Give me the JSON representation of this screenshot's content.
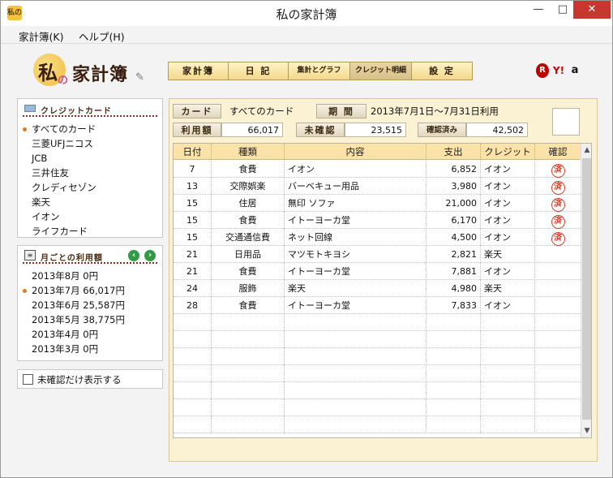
{
  "window": {
    "title": "私の家計簿",
    "icon_label": "私の"
  },
  "window_buttons": {
    "minimize": "—",
    "maximize": "□",
    "close": "✕"
  },
  "menu": {
    "items": [
      "家計簿(K)",
      "ヘルプ(H)"
    ]
  },
  "logo": {
    "part1": "私",
    "part2": "の",
    "part3": "家計簿"
  },
  "tabs": [
    "家計簿",
    "日 記",
    "集計とグラフ",
    "クレジット明細",
    "設 定"
  ],
  "active_tab": "クレジット明細",
  "partners": {
    "rakuten": "R",
    "yahoo": "Y!",
    "amazon": "a"
  },
  "credit_panel": {
    "title": "クレジットカード",
    "selected": "すべてのカード",
    "items": [
      "すべてのカード",
      "三菱UFJニコス",
      "JCB",
      "三井住友",
      "クレディセゾン",
      "楽天",
      "イオン",
      "ライフカード"
    ]
  },
  "month_panel": {
    "title": "月ごとの利用額",
    "prev": "‹",
    "next": "›",
    "selected": "2013年7月",
    "items": [
      {
        "label": "2013年8月",
        "amount": "0円"
      },
      {
        "label": "2013年7月",
        "amount": "66,017円"
      },
      {
        "label": "2013年6月",
        "amount": "25,587円"
      },
      {
        "label": "2013年5月",
        "amount": "38,775円"
      },
      {
        "label": "2013年4月",
        "amount": "0円"
      },
      {
        "label": "2013年3月",
        "amount": "0円"
      }
    ]
  },
  "filter": {
    "label": "未確認だけ表示する",
    "checked": false
  },
  "summary": {
    "card_label": "カード",
    "card_value": "すべてのカード",
    "period_label": "期 間",
    "period_value": "2013年7月1日～7月31日利用",
    "usage_label": "利用額",
    "usage_value": "66,017",
    "unconfirmed_label": "未確認",
    "unconfirmed_value": "23,515",
    "confirmed_label": "確認済み",
    "confirmed_value": "42,502"
  },
  "table": {
    "headers": [
      "日付",
      "種類",
      "内容",
      "支出",
      "クレジット",
      "確認"
    ],
    "stamp_text": "済",
    "rows": [
      {
        "date": "7",
        "kind": "食費",
        "desc": "イオン",
        "amount": "6,852",
        "card": "イオン",
        "confirmed": true
      },
      {
        "date": "13",
        "kind": "交際娯楽",
        "desc": "バーベキュー用品",
        "amount": "3,980",
        "card": "イオン",
        "confirmed": true
      },
      {
        "date": "15",
        "kind": "住居",
        "desc": "無印 ソファ",
        "amount": "21,000",
        "card": "イオン",
        "confirmed": true
      },
      {
        "date": "15",
        "kind": "食費",
        "desc": "イトーヨーカ堂",
        "amount": "6,170",
        "card": "イオン",
        "confirmed": true
      },
      {
        "date": "15",
        "kind": "交通通信費",
        "desc": "ネット回線",
        "amount": "4,500",
        "card": "イオン",
        "confirmed": true
      },
      {
        "date": "21",
        "kind": "日用品",
        "desc": "マツモトキヨシ",
        "amount": "2,821",
        "card": "楽天",
        "confirmed": false
      },
      {
        "date": "21",
        "kind": "食費",
        "desc": "イトーヨーカ堂",
        "amount": "7,881",
        "card": "イオン",
        "confirmed": false
      },
      {
        "date": "24",
        "kind": "服飾",
        "desc": "楽天",
        "amount": "4,980",
        "card": "楽天",
        "confirmed": false
      },
      {
        "date": "28",
        "kind": "食費",
        "desc": "イトーヨーカ堂",
        "amount": "7,833",
        "card": "イオン",
        "confirmed": false
      }
    ]
  },
  "icons": {
    "app": "app-icon",
    "card": "credit-card-icon",
    "calendar": "notebook-icon",
    "pencil": "pencil-icon",
    "stamp": "confirmed-stamp-icon"
  },
  "colors": {
    "tab_bg": "#f2d98a",
    "panel_bg": "#fbf1d3",
    "header_bg": "#fbe2a8",
    "stamp": "#d6402a",
    "bullet": "#e07b1a",
    "nav_btn": "#2f9b45",
    "close_btn": "#c7372f"
  }
}
